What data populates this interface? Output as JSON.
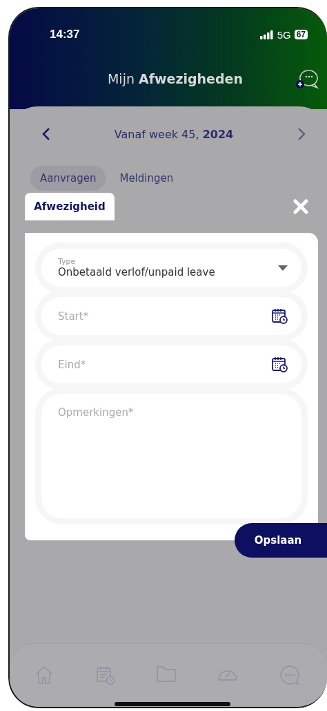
{
  "status_bar": {
    "time": "14:37",
    "network": "5G",
    "battery": "67"
  },
  "header": {
    "title": "Mijn **Afwezigheden**"
  },
  "week_nav": {
    "label": "Vanaf week 45, **2024**"
  },
  "tabs": [
    {
      "label": "Aanvragen",
      "selected": true
    },
    {
      "label": "Meldingen",
      "selected": false
    }
  ],
  "dialog": {
    "title": "Afwezigheid",
    "fields": [
      {
        "kind": "select",
        "label": "Type",
        "value": "Onbetaald verlof/unpaid leave"
      },
      {
        "kind": "date",
        "placeholder": "Start*"
      },
      {
        "kind": "date",
        "placeholder": "Eind*"
      },
      {
        "kind": "textarea",
        "placeholder": "Opmerkingen*"
      }
    ],
    "save_button": "Opslaan"
  },
  "bottom_nav": [
    {
      "kind": "home"
    },
    {
      "kind": "calendar"
    },
    {
      "kind": "folder"
    },
    {
      "kind": "gauge"
    },
    {
      "kind": "chat"
    }
  ]
}
